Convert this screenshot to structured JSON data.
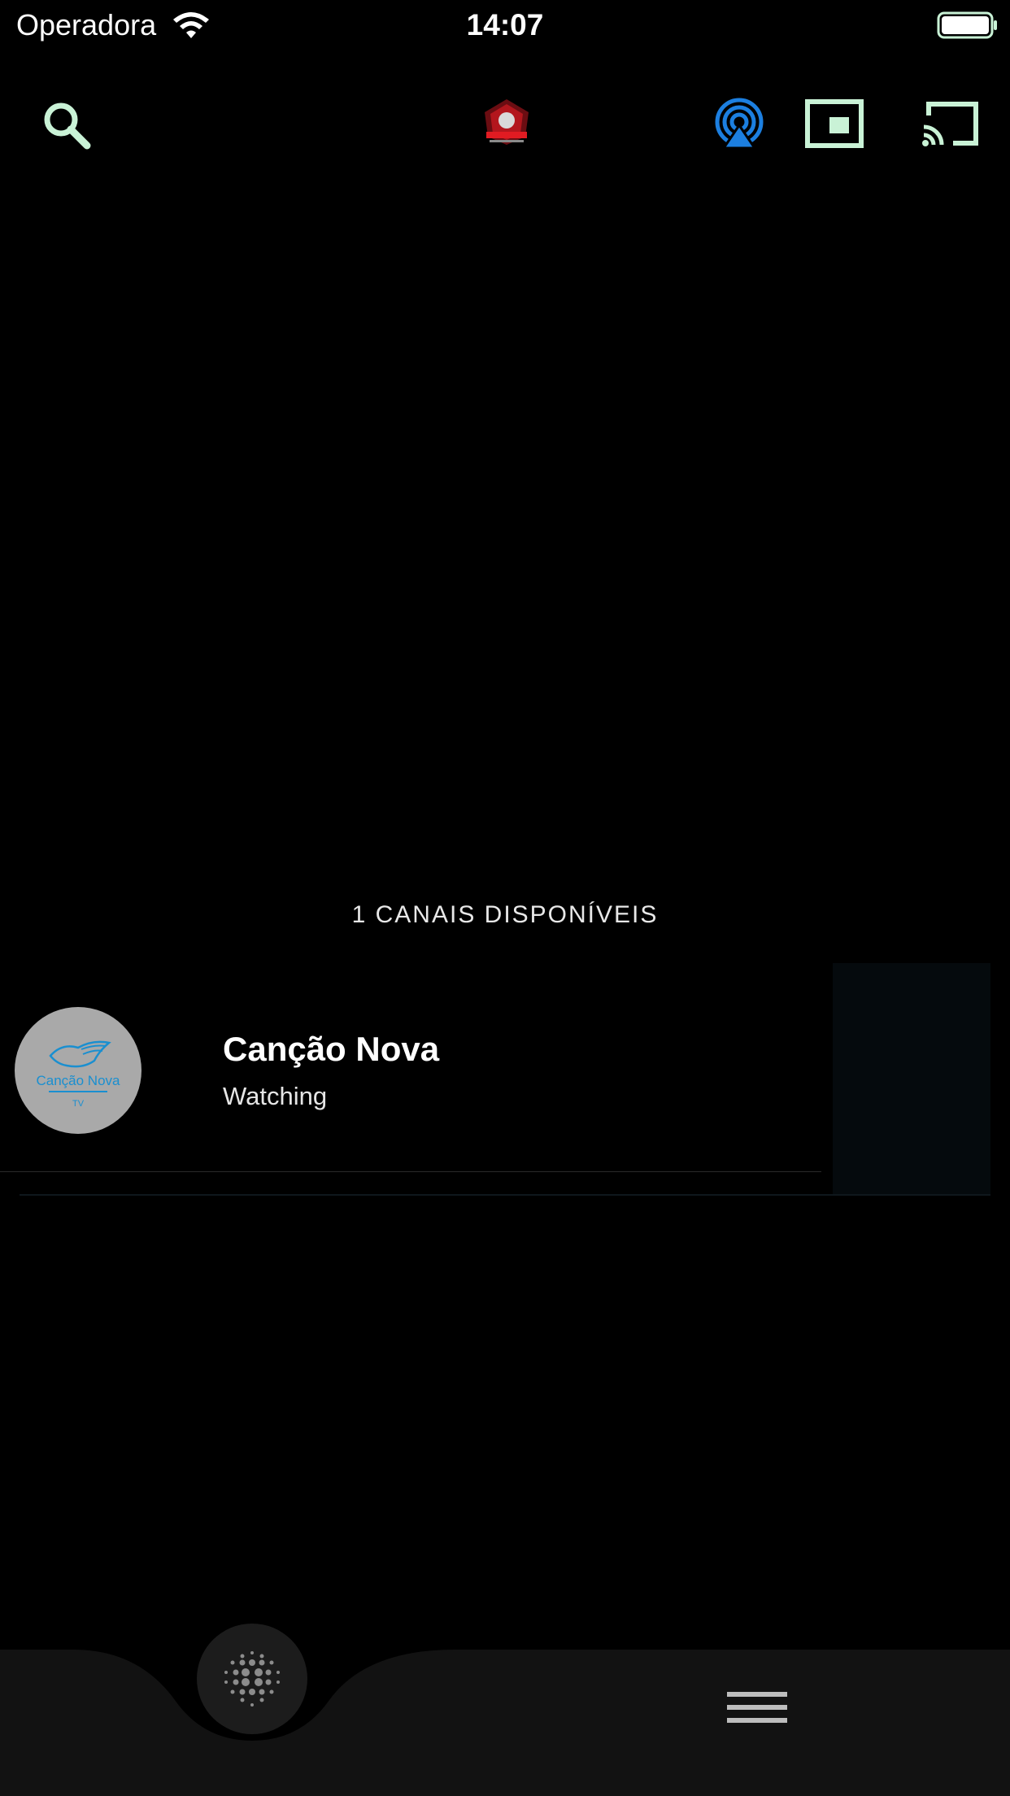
{
  "status_bar": {
    "carrier": "Operadora",
    "time": "14:07"
  },
  "toolbar": {
    "search_icon": "search-icon",
    "logo_icon": "app-logo",
    "airplay_icon": "airplay-icon",
    "pip_icon": "picture-in-picture-icon",
    "cast_icon": "cast-icon"
  },
  "channels": {
    "count_label": "1 CANAIS DISPONÍVEIS",
    "items": [
      {
        "name": "Canção Nova",
        "status": "Watching",
        "logo_text": "Canção Nova",
        "logo_sub": "TV"
      }
    ]
  },
  "tab_bar": {
    "center_icon": "dotted-circle-icon",
    "menu_icon": "hamburger-menu-icon"
  },
  "colors": {
    "background": "#000000",
    "accent_mint": "#c9f2d6",
    "airplay_blue": "#1c7fe0",
    "avatar_gray": "#a9a9a9",
    "logo_blue": "#1a8fd0",
    "tab_bar": "#121212"
  }
}
